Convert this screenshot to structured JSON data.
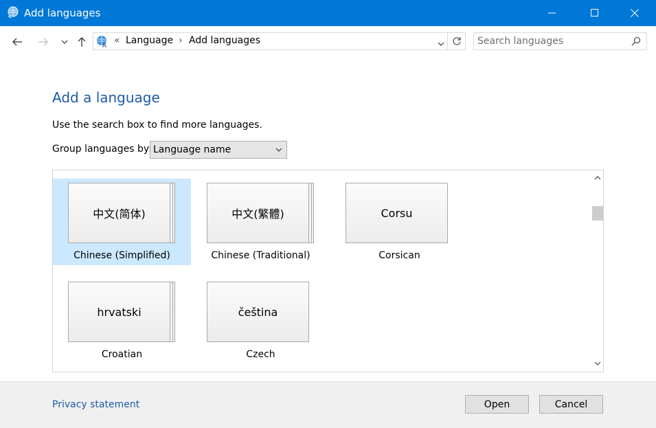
{
  "window": {
    "title": "Add languages"
  },
  "address": {
    "overflow_marker": "«",
    "crumbs": [
      "Language",
      "Add languages"
    ],
    "separator": "›"
  },
  "search": {
    "placeholder": "Search languages"
  },
  "main": {
    "heading": "Add a language",
    "instruction": "Use the search box to find more languages.",
    "group_label": "Group languages by:",
    "group_value": "Language name"
  },
  "languages": [
    {
      "native": "中文(简体)",
      "name": "Chinese (Simplified)",
      "selected": true,
      "stacked": true
    },
    {
      "native": "中文(繁體)",
      "name": "Chinese (Traditional)",
      "selected": false,
      "stacked": true
    },
    {
      "native": "Corsu",
      "name": "Corsican",
      "selected": false,
      "stacked": false
    },
    {
      "native": "hrvatski",
      "name": "Croatian",
      "selected": false,
      "stacked": true
    },
    {
      "native": "čeština",
      "name": "Czech",
      "selected": false,
      "stacked": false
    }
  ],
  "footer": {
    "privacy": "Privacy statement",
    "open": "Open",
    "cancel": "Cancel"
  },
  "colors": {
    "titlebar": "#0078d7",
    "selection": "#cce8ff",
    "link": "#1e5aa8"
  }
}
